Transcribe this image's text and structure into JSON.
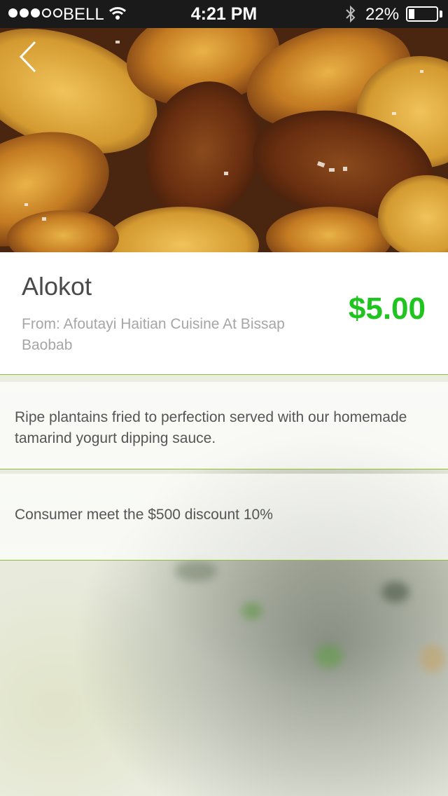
{
  "status_bar": {
    "carrier": "BELL",
    "time": "4:21 PM",
    "battery": "22%",
    "battery_level": 0.22,
    "signal_bars": 3,
    "signal_total": 5
  },
  "header": {
    "back_icon": "chevron-left-icon"
  },
  "item": {
    "name": "Alokot",
    "from": "From: Afoutayi Haitian Cuisine At Bissap Baobab",
    "price": "$5.00",
    "price_color": "#1fc41f"
  },
  "details": {
    "description": "Ripe plantains fried to perfection served with our homemade tamarind yogurt dipping sauce.",
    "discount": "Consumer meet the $500 discount 10%"
  },
  "colors": {
    "divider": "#8dbf3e",
    "status_bar_bg": "#1a1a1a"
  }
}
